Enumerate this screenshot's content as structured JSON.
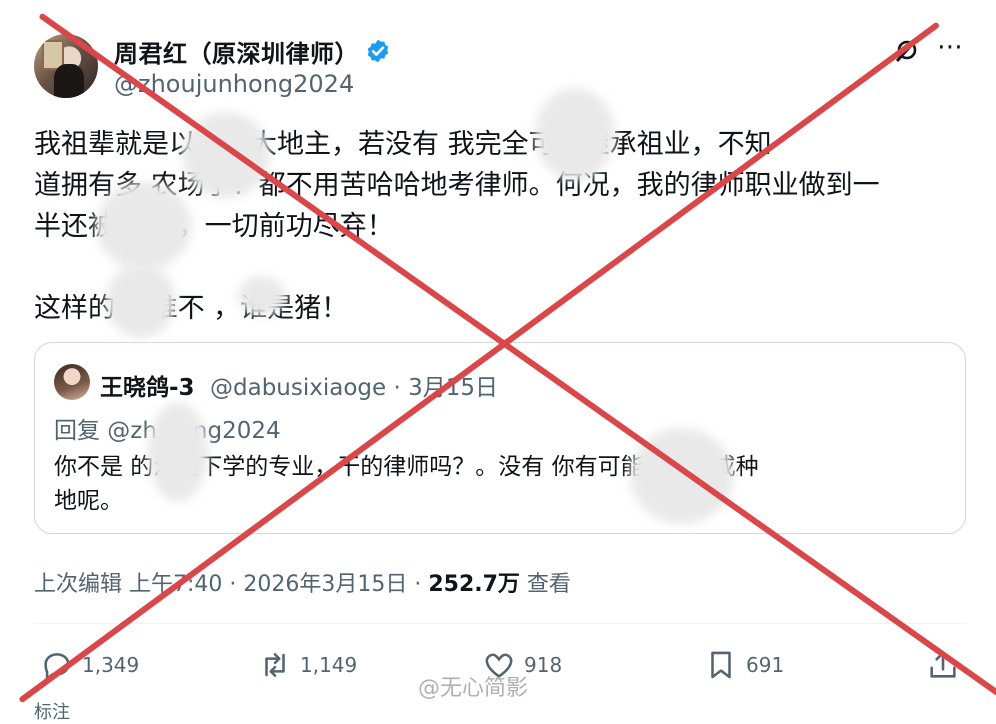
{
  "author": {
    "name": "周君红（原深圳律师）",
    "handle": "@zhoujunhong2024"
  },
  "tweet": {
    "lines": [
      "我祖辈就是以前的大地主，若没有 我完全可以继承祖业，不知",
      "道拥有多 农场了！都不用苦哈哈地考律师。何况，我的律师职业做到一",
      "半还被 夺了，一切前功尽弃！",
      "",
      "这样的 ，谁不 ，谁是猪！"
    ]
  },
  "quoted": {
    "name": "王晓鸽-3",
    "meta": "@dabusixiaoge · 3月15日",
    "reply_to": "回复 @zh hong2024",
    "lines": [
      "你不是 的治理下学的专业，干的律师吗？。没有 你有可能送外卖或种",
      "地呢。"
    ]
  },
  "meta": {
    "edited": "上次编辑 上午7:40 · 2026年3月15日 · ",
    "views": "252.7万",
    "views_label": " 查看"
  },
  "actions": {
    "replies": "1,349",
    "reposts": "1,149",
    "likes": "918",
    "bookmarks": "691"
  },
  "watermark": "@无心简影",
  "cutoff_text": "标注",
  "colors": {
    "verified": "#1d9bf0",
    "cross": "#d9474a",
    "secondary_text": "#536471"
  }
}
